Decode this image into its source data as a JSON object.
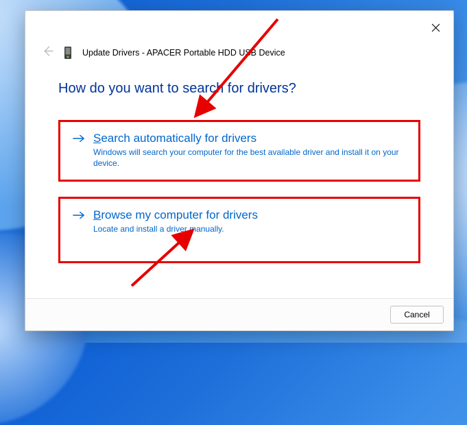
{
  "header": {
    "title": "Update Drivers - APACER Portable HDD USB Device"
  },
  "content": {
    "question": "How do you want to search for drivers?"
  },
  "options": {
    "auto": {
      "mnemonic": "S",
      "title_rest": "earch automatically for drivers",
      "desc": "Windows will search your computer for the best available driver and install it on your device."
    },
    "browse": {
      "mnemonic": "B",
      "title_rest": "rowse my computer for drivers",
      "desc": "Locate and install a driver manually."
    }
  },
  "footer": {
    "cancel": "Cancel"
  }
}
